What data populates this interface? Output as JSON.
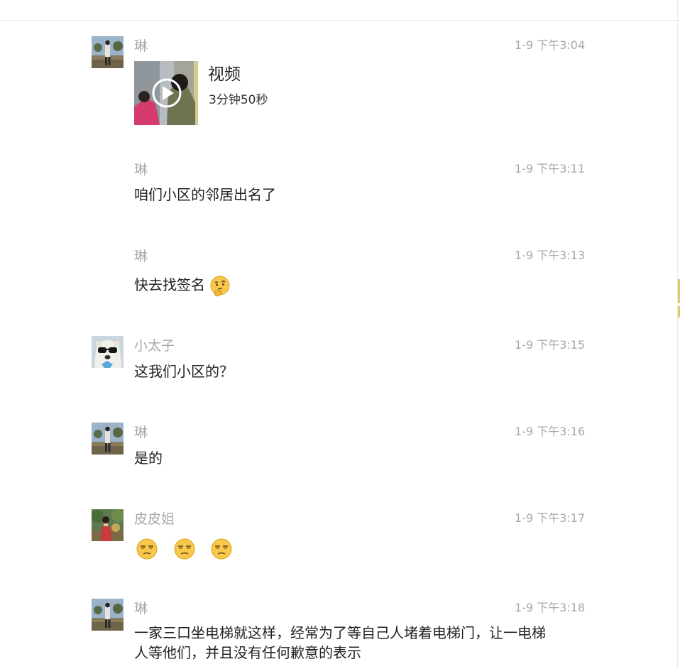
{
  "messages": [
    {
      "sender": "琳",
      "time": "1-9 下午3:04",
      "avatar": "avatar-lin",
      "video": {
        "title": "视频",
        "duration": "3分钟50秒",
        "icon": "play-icon"
      }
    },
    {
      "sender": "琳",
      "time": "1-9 下午3:11",
      "text": "咱们小区的邻居出名了"
    },
    {
      "sender": "琳",
      "time": "1-9 下午3:13",
      "text": "快去找签名",
      "emoji": "thinking-face-icon"
    },
    {
      "sender": "小太子",
      "time": "1-9 下午3:15",
      "avatar": "avatar-dog",
      "text": "这我们小区的？"
    },
    {
      "sender": "琳",
      "time": "1-9 下午3:16",
      "avatar": "avatar-lin",
      "text": "是的"
    },
    {
      "sender": "皮皮姐",
      "time": "1-9 下午3:17",
      "avatar": "avatar-pipi",
      "emojis": [
        "unamused-face-icon",
        "unamused-face-icon",
        "unamused-face-icon"
      ]
    },
    {
      "sender": "琳",
      "time": "1-9 下午3:18",
      "avatar": "avatar-lin",
      "text": "一家三口坐电梯就这样，经常为了等自己人堵着电梯门，让一电梯人等他们，并且没有任何歉意的表示"
    }
  ],
  "colors": {
    "meta_text": "#a8a8a8",
    "body_text": "#222222",
    "emoji_yellow": "#f7c84a",
    "side_marker": "#e9c46a"
  }
}
